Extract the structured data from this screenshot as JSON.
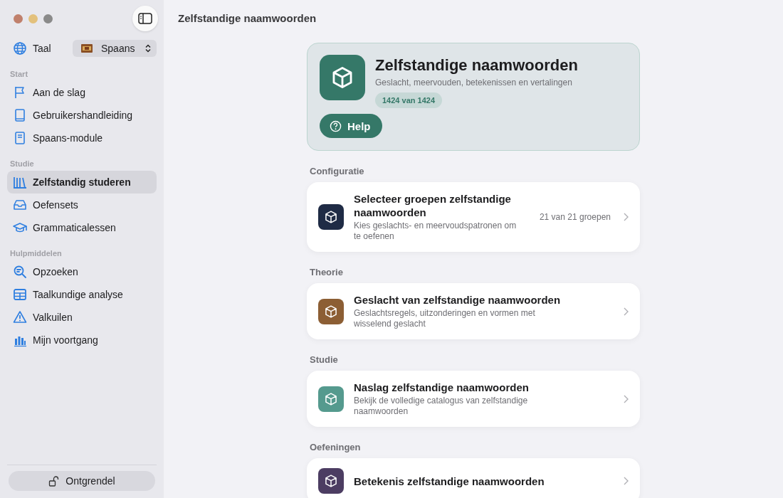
{
  "sidebar": {
    "language": {
      "label": "Taal",
      "value": "Spaans"
    },
    "sections": [
      {
        "title": "Start",
        "items": [
          {
            "label": "Aan de slag",
            "selected": false
          },
          {
            "label": "Gebruikershandleiding",
            "selected": false
          },
          {
            "label": "Spaans-module",
            "selected": false
          }
        ]
      },
      {
        "title": "Studie",
        "items": [
          {
            "label": "Zelfstandig studeren",
            "selected": true
          },
          {
            "label": "Oefensets",
            "selected": false
          },
          {
            "label": "Grammaticalessen",
            "selected": false
          }
        ]
      },
      {
        "title": "Hulpmiddelen",
        "items": [
          {
            "label": "Opzoeken",
            "selected": false
          },
          {
            "label": "Taalkundige analyse",
            "selected": false
          },
          {
            "label": "Valkuilen",
            "selected": false
          },
          {
            "label": "Mijn voortgang",
            "selected": false
          }
        ]
      }
    ],
    "unlock_button": "Ontgrendel"
  },
  "page_title": "Zelfstandige naamwoorden",
  "hero": {
    "title": "Zelfstandige naamwoorden",
    "subtitle": "Geslacht, meervouden, betekenissen en vertalingen",
    "count": "1424 van 1424",
    "help_button": "Help"
  },
  "sections": [
    {
      "title": "Configuratie",
      "card": {
        "title": "Selecteer groepen zelfstandige naamwoorden",
        "subtitle": "Kies geslachts- en meervoudspatronen om te oefenen",
        "detail": "21 van 21 groepen",
        "color": "#1f2b45"
      }
    },
    {
      "title": "Theorie",
      "card": {
        "title": "Geslacht van zelfstandige naamwoorden",
        "subtitle": "Geslachtsregels, uitzonderingen en vormen met wisselend geslacht",
        "color": "#8c5e34"
      }
    },
    {
      "title": "Studie",
      "card": {
        "title": "Naslag zelfstandige naamwoorden",
        "subtitle": "Bekijk de volledige catalogus van zelfstandige naamwoorden",
        "color": "#559a8e"
      }
    },
    {
      "title": "Oefeningen",
      "card": {
        "title": "Betekenis zelfstandige naamwoorden",
        "color": "#4c3d62"
      }
    }
  ]
}
